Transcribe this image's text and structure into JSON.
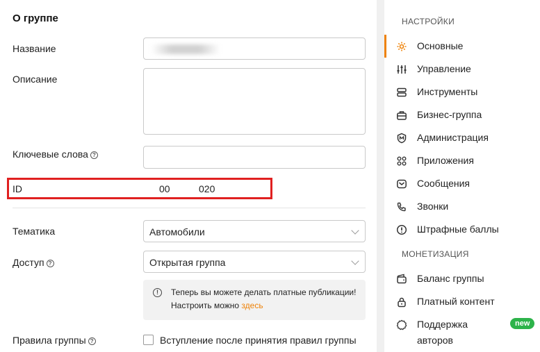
{
  "about": {
    "title": "О группе",
    "name_label": "Название",
    "description_label": "Описание",
    "keywords_label": "Ключевые слова",
    "id_label": "ID",
    "id_value_part1": "00",
    "id_value_part2": "020",
    "theme_label": "Тематика",
    "theme_value": "Автомобили",
    "access_label": "Доступ",
    "access_value": "Открытая группа",
    "notice_line1": "Теперь вы можете делать платные публикации!",
    "notice_line2_prefix": "Настроить можно ",
    "notice_link": "здесь",
    "rules_label": "Правила группы",
    "rules_checkbox_label": "Вступление после принятия правил группы"
  },
  "sidebar": {
    "settings_header": "НАСТРОЙКИ",
    "items": [
      {
        "label": "Основные",
        "icon": "gear-icon",
        "active": true
      },
      {
        "label": "Управление",
        "icon": "sliders-icon"
      },
      {
        "label": "Инструменты",
        "icon": "tools-icon"
      },
      {
        "label": "Бизнес-группа",
        "icon": "briefcase-icon"
      },
      {
        "label": "Администрация",
        "icon": "shield-icon"
      },
      {
        "label": "Приложения",
        "icon": "apps-icon"
      },
      {
        "label": "Сообщения",
        "icon": "mail-icon"
      },
      {
        "label": "Звонки",
        "icon": "phone-icon"
      },
      {
        "label": "Штрафные баллы",
        "icon": "warning-icon"
      }
    ],
    "monetization_header": "МОНЕТИЗАЦИЯ",
    "monetization_items": [
      {
        "label": "Баланс группы",
        "icon": "wallet-icon"
      },
      {
        "label": "Платный контент",
        "icon": "lock-icon"
      },
      {
        "label": "Поддержка",
        "label2": "авторов",
        "icon": "support-icon",
        "badge": "new"
      }
    ]
  },
  "colors": {
    "accent": "#ee8208",
    "highlight_box": "#e02020",
    "badge": "#2db34a"
  }
}
